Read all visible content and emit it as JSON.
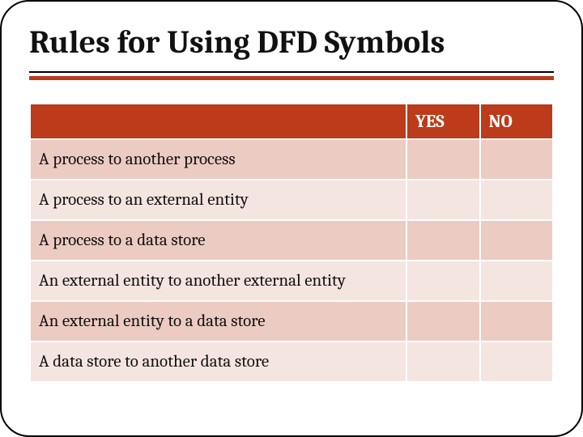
{
  "title": "Rules for Using DFD Symbols",
  "table": {
    "headers": {
      "blank": "",
      "yes": "YES",
      "no": "NO"
    },
    "rows": [
      {
        "desc": "A process to another process",
        "yes": "",
        "no": ""
      },
      {
        "desc": "A process to an external entity",
        "yes": "",
        "no": ""
      },
      {
        "desc": "A process to a data store",
        "yes": "",
        "no": ""
      },
      {
        "desc": "An external entity to another external entity",
        "yes": "",
        "no": ""
      },
      {
        "desc": "An external entity to a data store",
        "yes": "",
        "no": ""
      },
      {
        "desc": "A data store to another data store",
        "yes": "",
        "no": ""
      }
    ]
  }
}
